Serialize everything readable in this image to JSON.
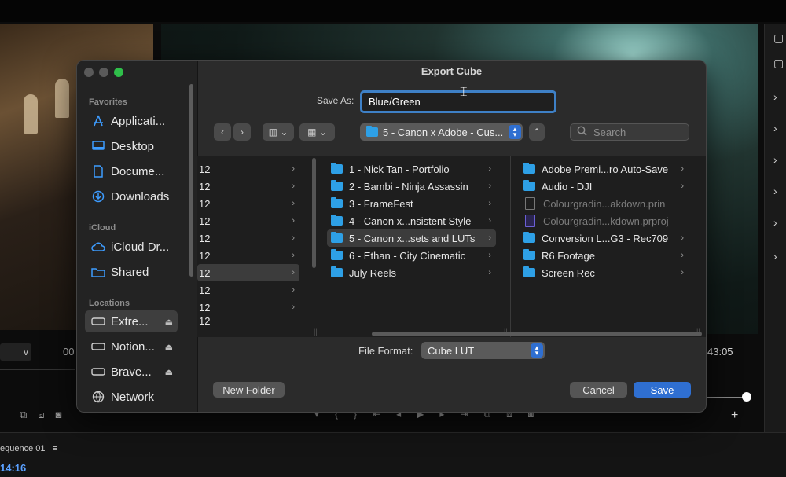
{
  "background": {
    "timecode_left": "00",
    "timecode_right": "43:05",
    "dropdown_left": "v",
    "sequence_label": "equence 01",
    "sequence_menu": "≡",
    "sequence_time": "14:16"
  },
  "dialog": {
    "title": "Export Cube",
    "save_as_label": "Save As:",
    "save_as_value": "Blue/Green",
    "location": "5 - Canon x Adobe - Cus...",
    "search_placeholder": "Search",
    "file_format_label": "File Format:",
    "file_format_value": "Cube LUT",
    "new_folder_label": "New Folder",
    "cancel_label": "Cancel",
    "save_label": "Save"
  },
  "sidebar": {
    "sections": [
      {
        "title": "Favorites",
        "items": [
          {
            "label": "Applicati...",
            "icon": "applications-icon"
          },
          {
            "label": "Desktop",
            "icon": "desktop-icon"
          },
          {
            "label": "Docume...",
            "icon": "documents-icon"
          },
          {
            "label": "Downloads",
            "icon": "downloads-icon"
          }
        ]
      },
      {
        "title": "iCloud",
        "items": [
          {
            "label": "iCloud Dr...",
            "icon": "cloud-icon"
          },
          {
            "label": "Shared",
            "icon": "shared-folder-icon"
          }
        ]
      },
      {
        "title": "Locations",
        "items": [
          {
            "label": "Extre...",
            "icon": "drive-icon"
          },
          {
            "label": "Notion...",
            "icon": "drive-icon"
          },
          {
            "label": "Brave...",
            "icon": "drive-icon"
          },
          {
            "label": "Network",
            "icon": "network-icon"
          }
        ]
      }
    ]
  },
  "columns": {
    "col1": [
      "12",
      "12",
      "12",
      "12",
      "12",
      "12",
      "12",
      "12",
      "12",
      "12"
    ],
    "col2": [
      "1 - Nick Tan - Portfolio",
      "2 - Bambi - Ninja Assassin",
      "3 - FrameFest",
      "4 - Canon x...nsistent Style",
      "5 - Canon x...sets and LUTs",
      "6 - Ethan - City Cinematic",
      "July Reels"
    ],
    "col3": [
      {
        "label": "Adobe Premi...ro Auto-Save",
        "type": "folder"
      },
      {
        "label": "Audio - DJI",
        "type": "folder"
      },
      {
        "label": "Colourgradin...akdown.prin",
        "type": "doc"
      },
      {
        "label": "Colourgradin...kdown.prproj",
        "type": "prproj"
      },
      {
        "label": "Conversion L...G3 - Rec709",
        "type": "folder"
      },
      {
        "label": "R6 Footage",
        "type": "folder"
      },
      {
        "label": "Screen Rec",
        "type": "folder"
      }
    ]
  },
  "colors": {
    "accent": "#2f6fd1",
    "folder": "#2ea0e6",
    "focus_ring": "#3e80c6"
  }
}
